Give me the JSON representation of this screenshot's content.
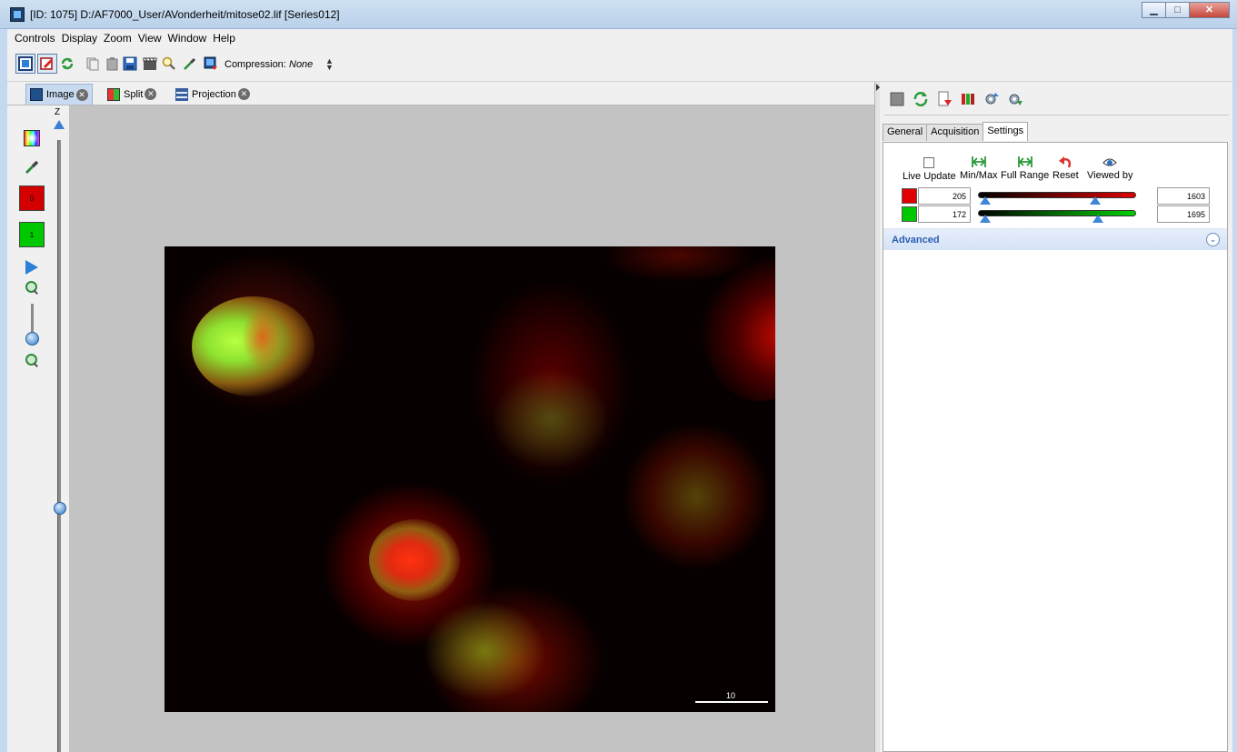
{
  "window": {
    "title": "[ID: 1075] D:/AF7000_User/AVonderheit/mitose02.lif [Series012]",
    "minimize": "▁",
    "maximize": "□",
    "close": "✕"
  },
  "menubar": {
    "items": [
      "Controls",
      "Display",
      "Zoom",
      "View",
      "Window",
      "Help"
    ]
  },
  "toolbar": {
    "compression_label": "Compression:",
    "compression_value": "None"
  },
  "view_tabs": [
    {
      "label": "Image"
    },
    {
      "label": "Split"
    },
    {
      "label": "Projection"
    }
  ],
  "left_tools": {
    "z_label": "Z",
    "channel_red_label": "0",
    "channel_green_label": "1"
  },
  "image": {
    "scale_bar_label": "10"
  },
  "right_panel": {
    "tabs": [
      "General",
      "Acquisition",
      "Settings"
    ],
    "active_tab": "Settings",
    "controls": {
      "live_update": "Live Update",
      "min_max": "Min/Max",
      "full_range": "Full Range",
      "reset": "Reset",
      "viewed_by": "Viewed by"
    },
    "channels": [
      {
        "color": "#e00000",
        "min": "205",
        "max": "1603"
      },
      {
        "color": "#00c800",
        "min": "172",
        "max": "1695"
      }
    ],
    "advanced_label": "Advanced"
  }
}
